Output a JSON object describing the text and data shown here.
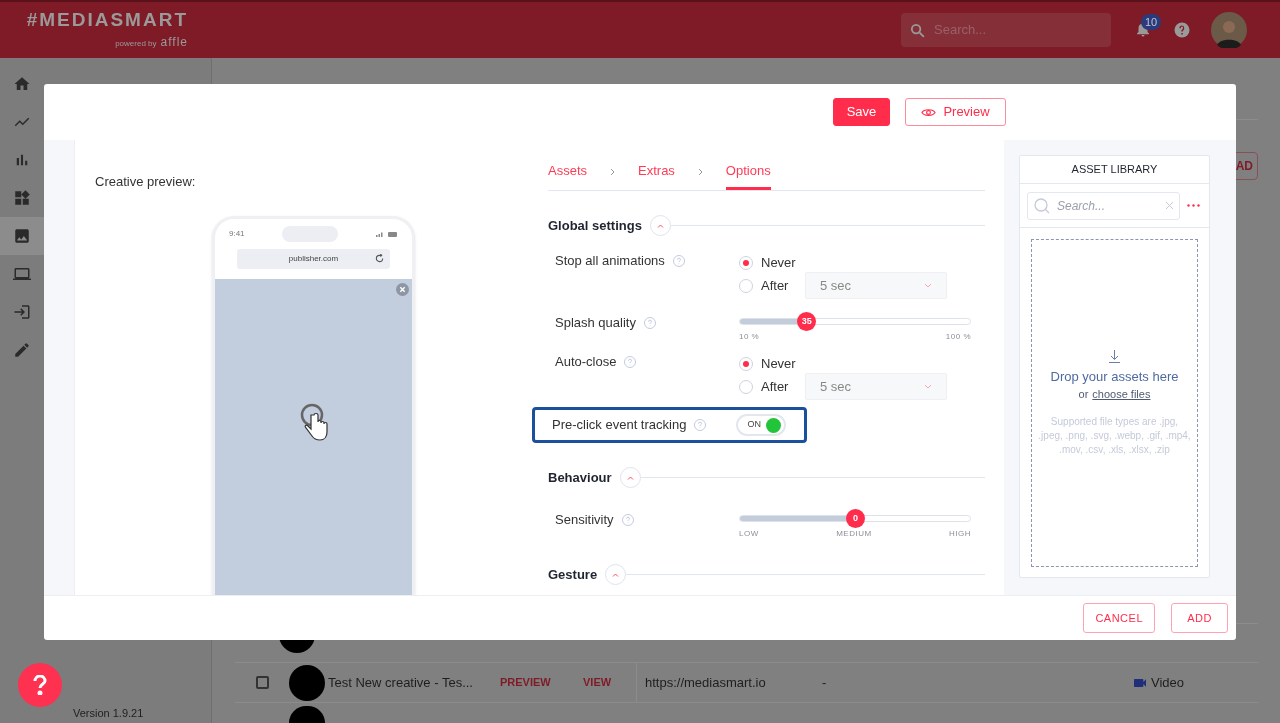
{
  "header": {
    "logo": "#MEDIASMART",
    "tagline": "powered by",
    "tagline_brand": "affle",
    "search": {
      "placeholder": "Search..."
    },
    "notifications": "10"
  },
  "nav_items": [
    {
      "selected": false
    },
    {
      "selected": false
    },
    {
      "selected": false
    },
    {
      "selected": false
    },
    {
      "selected": true
    },
    {
      "selected": false
    },
    {
      "selected": false
    },
    {
      "selected": false
    }
  ],
  "submenu": {
    "version": "Version 1.9.21"
  },
  "background": {
    "upload_button": "AD",
    "row": {
      "checked": false,
      "name": "Test New creative - Tes...",
      "preview": "PREVIEW",
      "view": "VIEW",
      "url": "https://mediasmart.io",
      "column_5": "-",
      "type": "Video"
    }
  },
  "modal": {
    "actions": [
      {
        "label": "Save",
        "kind": "primary"
      },
      {
        "label": "Preview",
        "kind": "outline"
      }
    ],
    "preview_label": "Creative preview:",
    "phone": {
      "time": "9:41",
      "url": "publisher.com"
    },
    "steps": [
      {
        "label": "Assets",
        "selected": false
      },
      {
        "label": "Extras",
        "selected": false
      },
      {
        "label": "Options",
        "selected": true
      }
    ],
    "sections": [
      {
        "title": "Global settings",
        "expanded": true,
        "settings": [
          {
            "kind": "radio",
            "label": "Stop all animations",
            "options": [
              {
                "label": "Never",
                "selected": true
              },
              {
                "label": "After",
                "selected": false,
                "dropdown": "5 sec"
              }
            ]
          },
          {
            "kind": "slider",
            "label": "Splash quality",
            "level": 0.29,
            "value": "35",
            "ticks": [
              "10 %",
              "100 %"
            ]
          },
          {
            "kind": "radio",
            "label": "Auto-close",
            "options": [
              {
                "label": "Never",
                "selected": true
              },
              {
                "label": "After",
                "selected": false,
                "dropdown": "5 sec"
              }
            ]
          },
          {
            "kind": "toggle",
            "label": "Pre-click event tracking",
            "highlighted": true,
            "on": true,
            "state_label": "ON"
          }
        ]
      },
      {
        "title": "Behaviour",
        "expanded": true,
        "settings": [
          {
            "kind": "slider",
            "label": "Sensitivity",
            "level": 0.5,
            "value": "0",
            "ticks": [
              "LOW",
              "MEDIUM",
              "HIGH"
            ]
          }
        ]
      },
      {
        "title": "Gesture",
        "expanded": true
      }
    ],
    "asset_library": {
      "title": "ASSET LIBRARY",
      "search": {
        "placeholder": "Search..."
      },
      "drop_text": "Drop your assets here",
      "or_text": "or",
      "link": "choose files",
      "supported": "Supported file types are .jpg, .jpeg, .png, .svg, .webp, .gif, .mp4, .mov, .csv, .xls, .xlsx, .zip"
    },
    "footer_buttons": [
      "CANCEL",
      "ADD"
    ]
  }
}
